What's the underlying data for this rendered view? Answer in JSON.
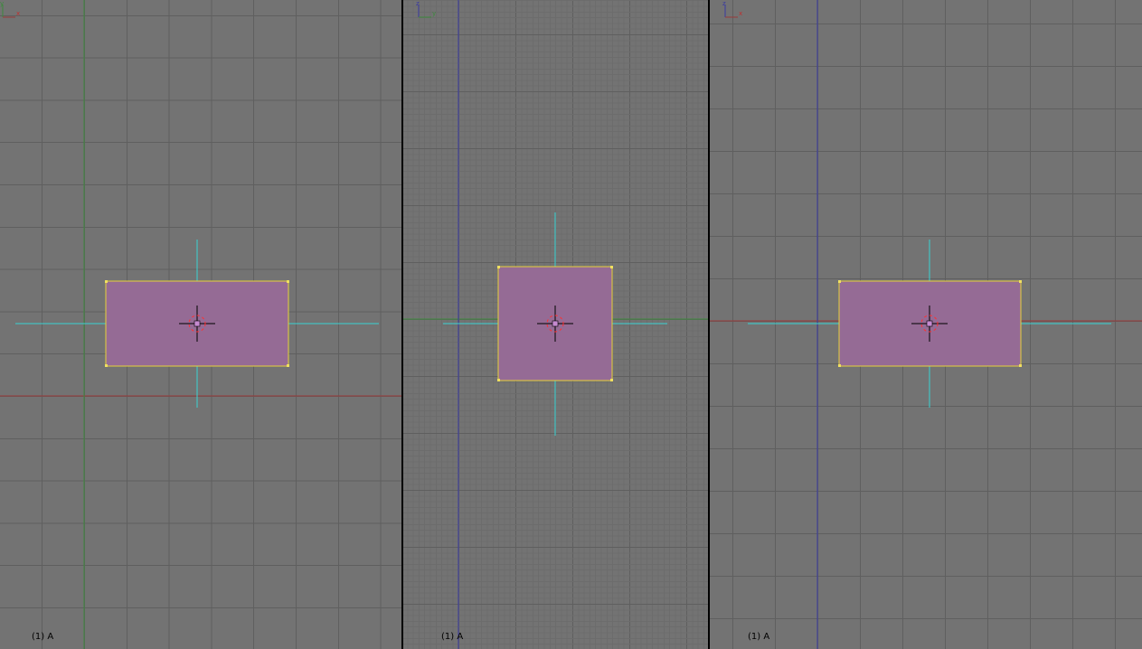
{
  "viewports": [
    {
      "id": "front",
      "label": "(1) A",
      "gizmo": {
        "vertical": "y",
        "horizontal": "x"
      }
    },
    {
      "id": "side",
      "label": "(1) A",
      "gizmo": {
        "vertical": "z",
        "horizontal": "y"
      }
    },
    {
      "id": "top",
      "label": "(1) A",
      "gizmo": {
        "vertical": "z",
        "horizontal": "x"
      }
    }
  ],
  "colors": {
    "background": "#737373",
    "grid_minor": "#6c6c6c",
    "grid_major": "#5f5f5f",
    "axis_x": "#9a3a3a",
    "axis_y": "#3d8a3d",
    "axis_z": "#3a3aa0",
    "object_fill": "#956b95",
    "object_outline": "#e6d23a",
    "lamp_lines": "#38d3d3",
    "cursor": "#000000",
    "cursor_ring": "#ff3030"
  }
}
